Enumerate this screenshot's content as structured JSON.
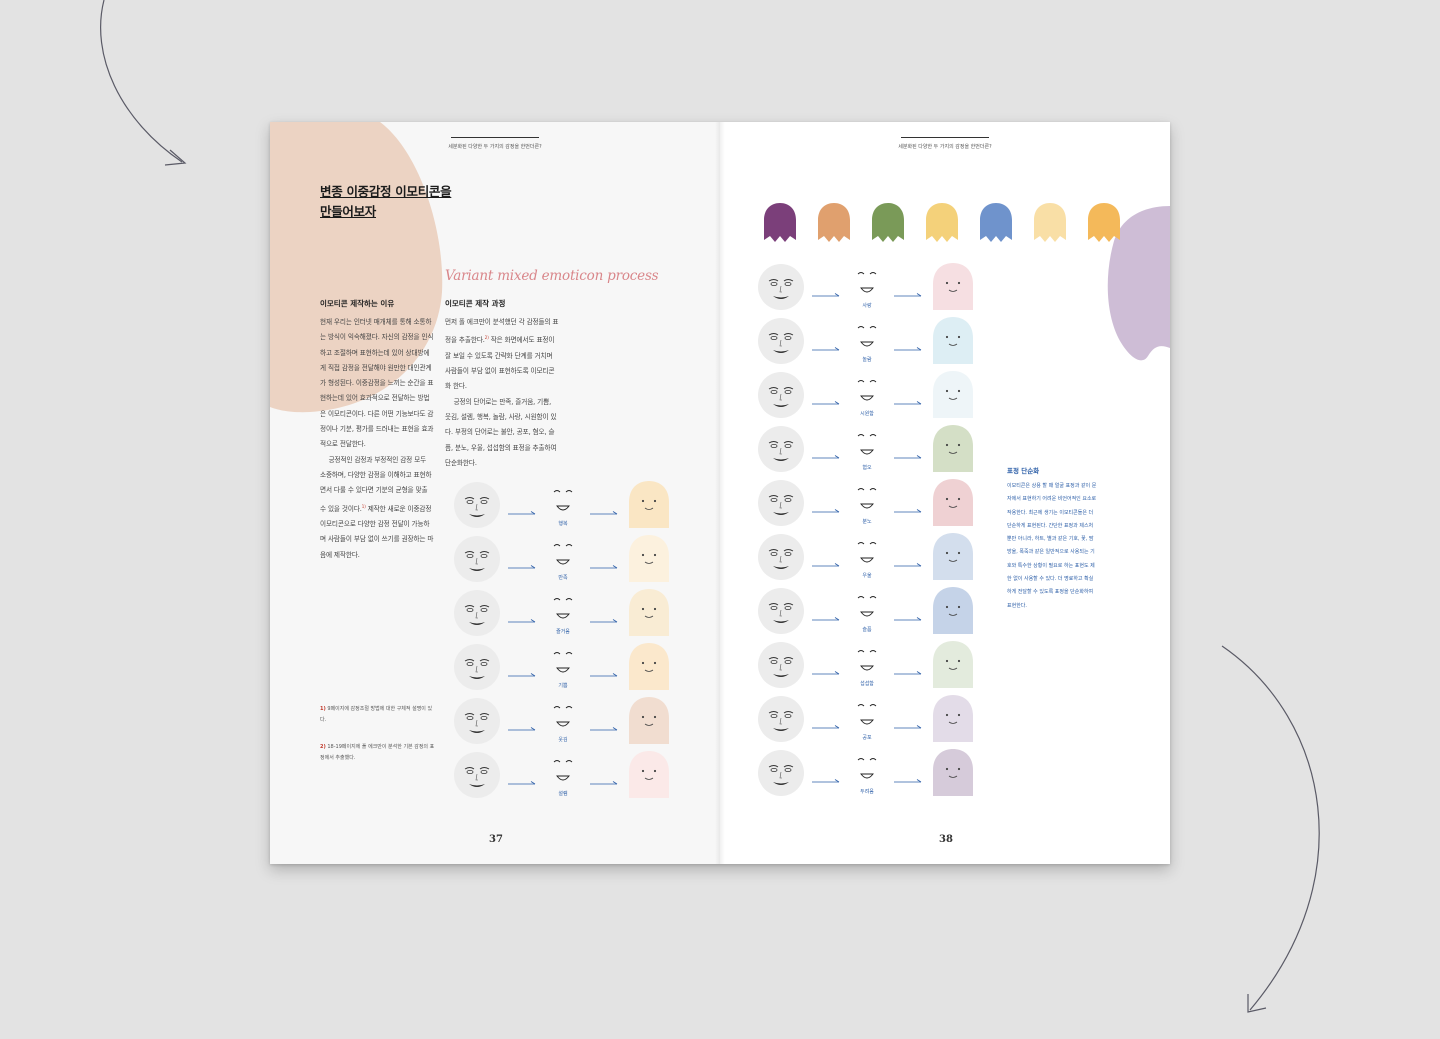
{
  "left_page": {
    "running_head": "세분화된 다양한 두 가지의 감정을 한번더른?",
    "title_lines": [
      "변종 이중감정 이모티콘을",
      "만들어보자"
    ],
    "english_title": "Variant mixed emoticon process",
    "col1": {
      "heading": "이모티콘 제작하는 이유",
      "para1": "현재 우리는 인터넷 매개체를 통해 소통하는 방식이 익숙해졌다. 자신의 감정을 인식하고 조절하며 표현하는데 있어 상대방에게 직접 감정을 전달해야 원만한 대인관계가 형성된다. 이중감정을 느끼는 순간을 표현하는데 있어 효과적으로 전달하는 방법은 이모티콘이다. 다른 어떤 기능보다도 감정이나 기분, 평가를 드러내는 표현을 효과적으로 전달한다.",
      "para2": "긍정적인 감정과 부정적인 감정 모두 소중하며, 다양한 감정을 이해하고 표현하면서 다룰 수 있다면 기분의 균형을 맞출 수 있을 것이다.",
      "para2_sup": "1)",
      "para3": "제작한 새로운 이중감정 이모티콘으로 다양한 감정 전달이 가능하며 사람들이 부담 없이 쓰기를 권장하는 마음에 제작한다."
    },
    "col2": {
      "heading": "이모티콘 제작 과정",
      "para1a": "먼저 폴 에크만이 분석했던 각 감정들의 표정을 추출한다.",
      "para1_sup": "2)",
      "para1b": " 작은 화면에서도 표정이 잘 보일 수 있도록 간략화 단계를 거치며 사람들이 부담 없이 표현하도록 이모티콘화 한다.",
      "para2": "긍정의 단어로는 만족, 즐거움, 기쁨, 웃김, 설렘, 행복, 놀람, 사랑, 시원함이 있다. 부정의 단어로는 불안, 공포, 혐오, 슬픔, 분노, 우울, 섭섭함의 표정을 추출하여 단순화한다."
    },
    "footnotes": [
      {
        "mark": "1)",
        "text": "9페이지에 감정조절 방법에 대한 구체적 설명이 있다."
      },
      {
        "mark": "2)",
        "text": "18-19페이지에 폴 에크만이 분석한 기본 감정의 표정에서 추출했다."
      }
    ],
    "rows": [
      {
        "label": "행복",
        "ghost_color": "#fae6c4"
      },
      {
        "label": "만족",
        "ghost_color": "#fcf1de"
      },
      {
        "label": "즐거움",
        "ghost_color": "#f9ecd4"
      },
      {
        "label": "기쁨",
        "ghost_color": "#fbe8cc"
      },
      {
        "label": "웃김",
        "ghost_color": "#f1ddd0"
      },
      {
        "label": "설렘",
        "ghost_color": "#fbe9e8"
      }
    ],
    "folio": "37"
  },
  "right_page": {
    "running_head": "세분화된 다양한 두 가지의 감정을 한번더른?",
    "palette": [
      "#7b3f7a",
      "#e0a06e",
      "#7a9a58",
      "#f4d17a",
      "#6f93cc",
      "#f9dfa6",
      "#f4b95a"
    ],
    "rows": [
      {
        "label": "사랑",
        "ghost_color": "#f6dfe2"
      },
      {
        "label": "놀람",
        "ghost_color": "#ddeef4"
      },
      {
        "label": "시원함",
        "ghost_color": "#eef5f8"
      },
      {
        "label": "혐오",
        "ghost_color": "#d4dfc6"
      },
      {
        "label": "분노",
        "ghost_color": "#efd1d3"
      },
      {
        "label": "우울",
        "ghost_color": "#d3deed"
      },
      {
        "label": "슬픔",
        "ghost_color": "#c5d3e8"
      },
      {
        "label": "섭섭함",
        "ghost_color": "#e3ebdd"
      },
      {
        "label": "공포",
        "ghost_color": "#e3dce8"
      },
      {
        "label": "두려움",
        "ghost_color": "#d6cbda"
      }
    ],
    "side_heading": "표정 단순화",
    "side_text": "이모티콘은 상용 할 때 얼굴 표정과 같이 문자에서 표현하기 어려운 비언어적인 요소로 작용한다. 최근에 생기는 이모티콘들은 더 단순하게 표현된다. 간단한 표정과 제스처 뿐만 아니라, 하트, 별과 같은 기호, 꽃, 땀방울, 폭죽과 같은 일반적으로 사용되는 기호와 특수한 상황이 필요로 하는 표현도 제한 없이 사용할 수 있다. 더 명료하고 확실하게 전달할 수 있도록 표정을 단순화하여 표현한다.",
    "folio": "38"
  }
}
